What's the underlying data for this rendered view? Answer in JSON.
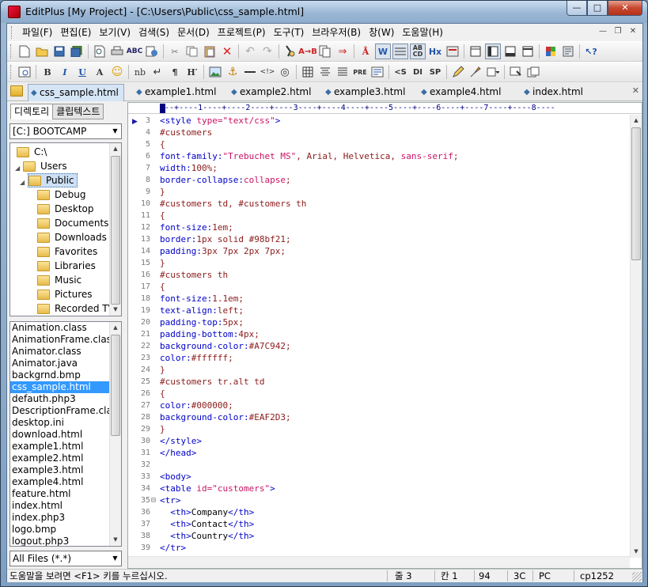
{
  "window": {
    "title": "EditPlus [My Project] - [C:\\Users\\Public\\css_sample.html]"
  },
  "menu": [
    "파일(F)",
    "편집(E)",
    "보기(V)",
    "검색(S)",
    "문서(D)",
    "프로젝트(P)",
    "도구(T)",
    "브라우저(B)",
    "창(W)",
    "도움말(H)"
  ],
  "toolbar2_text": {
    "nb": "nb",
    "pre": "PRE",
    "s": "<S",
    "di": "DI",
    "sp": "SP",
    "hx": "Hx"
  },
  "file_tabs": [
    "css_sample.html",
    "example1.html",
    "example2.html",
    "example3.html",
    "example4.html",
    "index.html"
  ],
  "left_panel": {
    "tabs": [
      "디렉토리",
      "클립텍스트"
    ],
    "drive": "[C:] BOOTCAMP",
    "tree": [
      "C:\\",
      "Users",
      "Public",
      "Debug",
      "Desktop",
      "Documents",
      "Downloads",
      "Favorites",
      "Libraries",
      "Music",
      "Pictures",
      "Recorded TV"
    ],
    "files": [
      "Animation.class",
      "AnimationFrame.class",
      "Animator.class",
      "Animator.java",
      "backgrnd.bmp",
      "css_sample.html",
      "defauth.php3",
      "DescriptionFrame.class",
      "desktop.ini",
      "download.html",
      "example1.html",
      "example2.html",
      "example3.html",
      "example4.html",
      "feature.html",
      "index.html",
      "index.php3",
      "logo.bmp",
      "logout.php3"
    ],
    "selected_file": "css_sample.html",
    "filter": "All Files (*.*)"
  },
  "editor": {
    "ruler": "---+----1----+----2----+----3----+----4----+----5----+----6----+----7----+----8----",
    "lines": [
      {
        "n": "3",
        "fold": "",
        "segs": [
          [
            "tag",
            "<style "
          ],
          [
            "attr",
            "type="
          ],
          [
            "str",
            "\"text/css\""
          ],
          [
            "tag",
            ">"
          ]
        ]
      },
      {
        "n": "4",
        "fold": "",
        "segs": [
          [
            "sel",
            "#customers"
          ]
        ]
      },
      {
        "n": "5",
        "fold": "",
        "segs": [
          [
            "brace",
            "{"
          ]
        ]
      },
      {
        "n": "6",
        "fold": "",
        "segs": [
          [
            "prop",
            "font-family:"
          ],
          [
            "str",
            "\"Trebuchet MS\""
          ],
          [
            "val",
            ", Arial, Helvetica, "
          ],
          [
            "str",
            "sans-serif"
          ],
          [
            "val",
            ";"
          ]
        ]
      },
      {
        "n": "7",
        "fold": "",
        "segs": [
          [
            "prop",
            "width:"
          ],
          [
            "val",
            "100%;"
          ]
        ]
      },
      {
        "n": "8",
        "fold": "",
        "segs": [
          [
            "prop",
            "border-collapse:"
          ],
          [
            "str",
            "collapse"
          ],
          [
            "val",
            ";"
          ]
        ]
      },
      {
        "n": "9",
        "fold": "",
        "segs": [
          [
            "brace",
            "}"
          ]
        ]
      },
      {
        "n": "10",
        "fold": "",
        "segs": [
          [
            "sel",
            "#customers td, #customers th"
          ]
        ]
      },
      {
        "n": "11",
        "fold": "",
        "segs": [
          [
            "brace",
            "{"
          ]
        ]
      },
      {
        "n": "12",
        "fold": "",
        "segs": [
          [
            "prop",
            "font-size:"
          ],
          [
            "val",
            "1em;"
          ]
        ]
      },
      {
        "n": "13",
        "fold": "",
        "segs": [
          [
            "prop",
            "border:"
          ],
          [
            "val",
            "1px solid #98bf21;"
          ]
        ]
      },
      {
        "n": "14",
        "fold": "",
        "segs": [
          [
            "prop",
            "padding:"
          ],
          [
            "val",
            "3px 7px 2px 7px;"
          ]
        ]
      },
      {
        "n": "15",
        "fold": "",
        "segs": [
          [
            "brace",
            "}"
          ]
        ]
      },
      {
        "n": "16",
        "fold": "",
        "segs": [
          [
            "sel",
            "#customers th"
          ]
        ]
      },
      {
        "n": "17",
        "fold": "",
        "segs": [
          [
            "brace",
            "{"
          ]
        ]
      },
      {
        "n": "18",
        "fold": "",
        "segs": [
          [
            "prop",
            "font-size:"
          ],
          [
            "val",
            "1.1em;"
          ]
        ]
      },
      {
        "n": "19",
        "fold": "",
        "segs": [
          [
            "prop",
            "text-align:"
          ],
          [
            "val",
            "left;"
          ]
        ]
      },
      {
        "n": "20",
        "fold": "",
        "segs": [
          [
            "prop",
            "padding-top:"
          ],
          [
            "val",
            "5px;"
          ]
        ]
      },
      {
        "n": "21",
        "fold": "",
        "segs": [
          [
            "prop",
            "padding-bottom:"
          ],
          [
            "val",
            "4px;"
          ]
        ]
      },
      {
        "n": "22",
        "fold": "",
        "segs": [
          [
            "prop",
            "background-color:"
          ],
          [
            "val",
            "#A7C942;"
          ]
        ]
      },
      {
        "n": "23",
        "fold": "",
        "segs": [
          [
            "prop",
            "color:"
          ],
          [
            "val",
            "#ffffff;"
          ]
        ]
      },
      {
        "n": "24",
        "fold": "",
        "segs": [
          [
            "brace",
            "}"
          ]
        ]
      },
      {
        "n": "25",
        "fold": "",
        "segs": [
          [
            "sel",
            "#customers tr.alt td"
          ]
        ]
      },
      {
        "n": "26",
        "fold": "",
        "segs": [
          [
            "brace",
            "{"
          ]
        ]
      },
      {
        "n": "27",
        "fold": "",
        "segs": [
          [
            "prop",
            "color:"
          ],
          [
            "val",
            "#000000;"
          ]
        ]
      },
      {
        "n": "28",
        "fold": "",
        "segs": [
          [
            "prop",
            "background-color:"
          ],
          [
            "val",
            "#EAF2D3;"
          ]
        ]
      },
      {
        "n": "29",
        "fold": "",
        "segs": [
          [
            "brace",
            "}"
          ]
        ]
      },
      {
        "n": "30",
        "fold": "",
        "segs": [
          [
            "tag",
            "</style>"
          ]
        ]
      },
      {
        "n": "31",
        "fold": "",
        "segs": [
          [
            "tag",
            "</head>"
          ]
        ]
      },
      {
        "n": "32",
        "fold": "",
        "segs": []
      },
      {
        "n": "33",
        "fold": "",
        "segs": [
          [
            "tag",
            "<body>"
          ]
        ]
      },
      {
        "n": "34",
        "fold": "",
        "segs": [
          [
            "tag",
            "<table "
          ],
          [
            "attr",
            "id="
          ],
          [
            "str",
            "\"customers\""
          ],
          [
            "tag",
            ">"
          ]
        ]
      },
      {
        "n": "35",
        "fold": "⊟",
        "segs": [
          [
            "tag",
            "<tr>"
          ]
        ]
      },
      {
        "n": "36",
        "fold": "",
        "segs": [
          [
            "txt",
            "  "
          ],
          [
            "tag",
            "<th>"
          ],
          [
            "txt",
            "Company"
          ],
          [
            "tag",
            "</th>"
          ]
        ]
      },
      {
        "n": "37",
        "fold": "",
        "segs": [
          [
            "txt",
            "  "
          ],
          [
            "tag",
            "<th>"
          ],
          [
            "txt",
            "Contact"
          ],
          [
            "tag",
            "</th>"
          ]
        ]
      },
      {
        "n": "38",
        "fold": "",
        "segs": [
          [
            "txt",
            "  "
          ],
          [
            "tag",
            "<th>"
          ],
          [
            "txt",
            "Country"
          ],
          [
            "tag",
            "</th>"
          ]
        ]
      },
      {
        "n": "39",
        "fold": "",
        "segs": [
          [
            "tag",
            "</tr>"
          ]
        ]
      }
    ]
  },
  "status": {
    "help": "도움말을 보려면 <F1> 키를 누르십시오.",
    "line": "줄 3",
    "col": "칸 1",
    "total": "94",
    "hex": "3C",
    "mode": "PC",
    "encoding": "cp1252"
  },
  "colors": {
    "tag": "#0000c8",
    "attr": "#c81464",
    "selector": "#8b1a1a",
    "selection": "#3399ff"
  }
}
